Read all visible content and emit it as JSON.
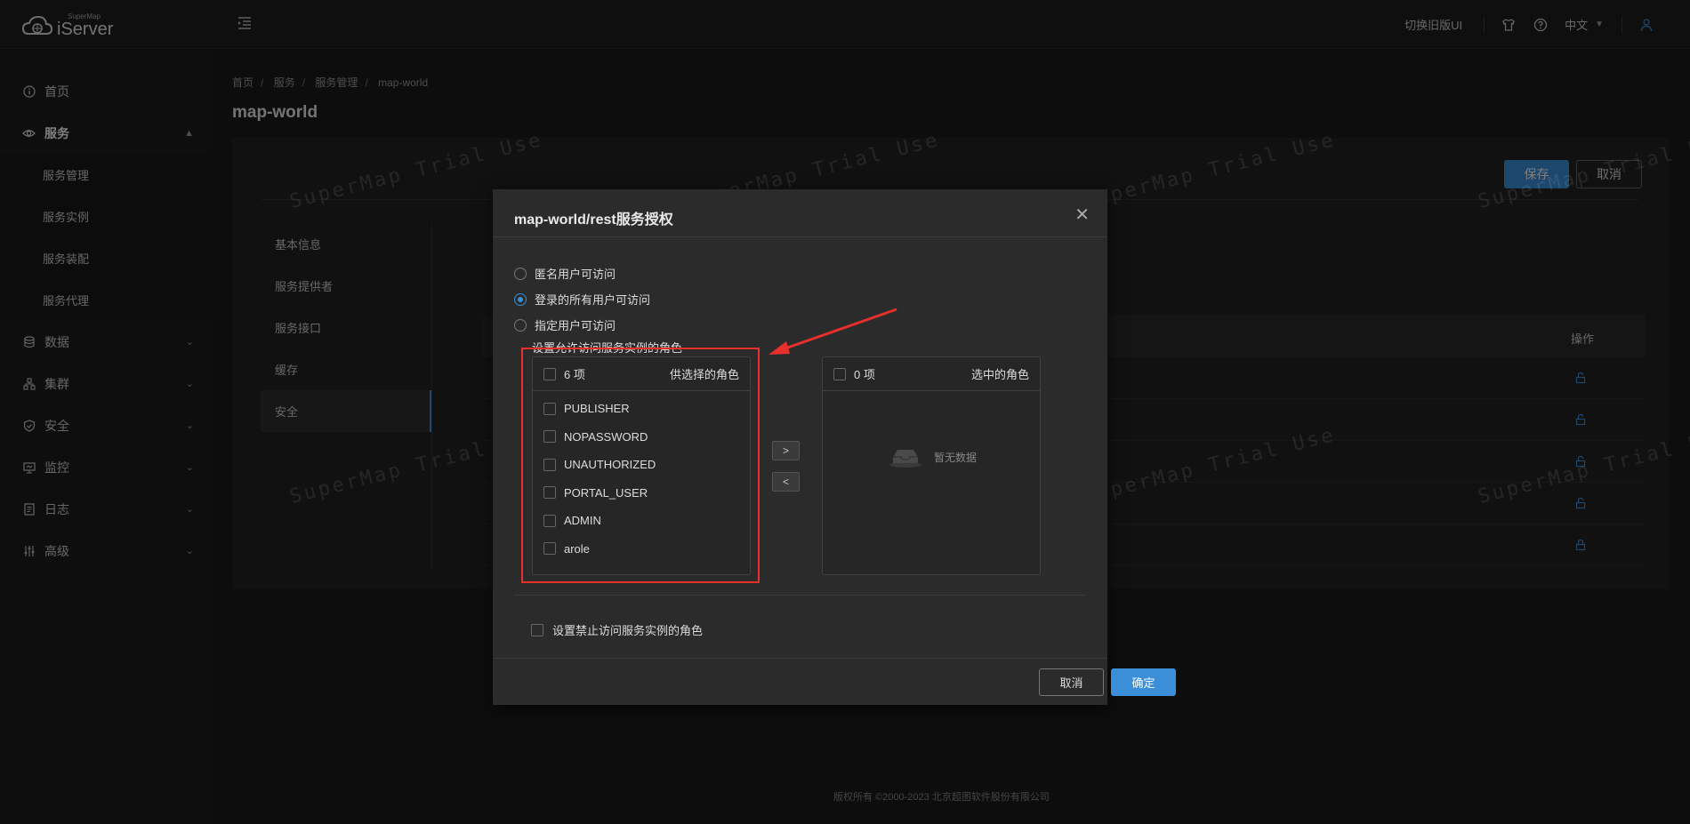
{
  "app": {
    "logo_small": "SuperMap",
    "logo_big": "iServer",
    "switch_ui": "切换旧版UI",
    "lang": "中文"
  },
  "sidebar": {
    "items": [
      {
        "label": "首页",
        "icon": "info-circle-icon"
      },
      {
        "label": "服务",
        "icon": "eye-icon",
        "open": true
      },
      {
        "label": "数据",
        "icon": "database-icon"
      },
      {
        "label": "集群",
        "icon": "cluster-icon"
      },
      {
        "label": "安全",
        "icon": "shield-icon"
      },
      {
        "label": "监控",
        "icon": "monitor-icon"
      },
      {
        "label": "日志",
        "icon": "log-icon"
      },
      {
        "label": "高级",
        "icon": "sliders-icon"
      }
    ],
    "sub_items": [
      "服务管理",
      "服务实例",
      "服务装配",
      "服务代理"
    ]
  },
  "breadcrumb": [
    "首页",
    "服务",
    "服务管理",
    "map-world"
  ],
  "page_title": "map-world",
  "panel": {
    "save": "保存",
    "cancel": "取消",
    "tabs": [
      "基本信息",
      "服务提供者",
      "服务接口",
      "缓存",
      "安全"
    ],
    "active_tab": "安全",
    "table_op_header": "操作"
  },
  "watermark": "SuperMap Trial Use",
  "footer": "版权所有 ©2000-2023 北京超图软件股份有限公司",
  "modal": {
    "title": "map-world/rest服务授权",
    "radios": [
      {
        "label": "匿名用户可访问",
        "checked": false
      },
      {
        "label": "登录的所有用户可访问",
        "checked": true
      },
      {
        "label": "指定用户可访问",
        "checked": false
      }
    ],
    "allow_label": "设置允许访问服务实例的角色",
    "source": {
      "count": "6 项",
      "title": "供选择的角色",
      "items": [
        "PUBLISHER",
        "NOPASSWORD",
        "UNAUTHORIZED",
        "PORTAL_USER",
        "ADMIN",
        "arole"
      ]
    },
    "target": {
      "count": "0 项",
      "title": "选中的角色",
      "empty": "暂无数据"
    },
    "move_right": ">",
    "move_left": "<",
    "deny_label": "设置禁止访问服务实例的角色",
    "cancel": "取消",
    "ok": "确定"
  },
  "colors": {
    "accent": "#3b8fd9",
    "annotation": "#e5302b"
  }
}
